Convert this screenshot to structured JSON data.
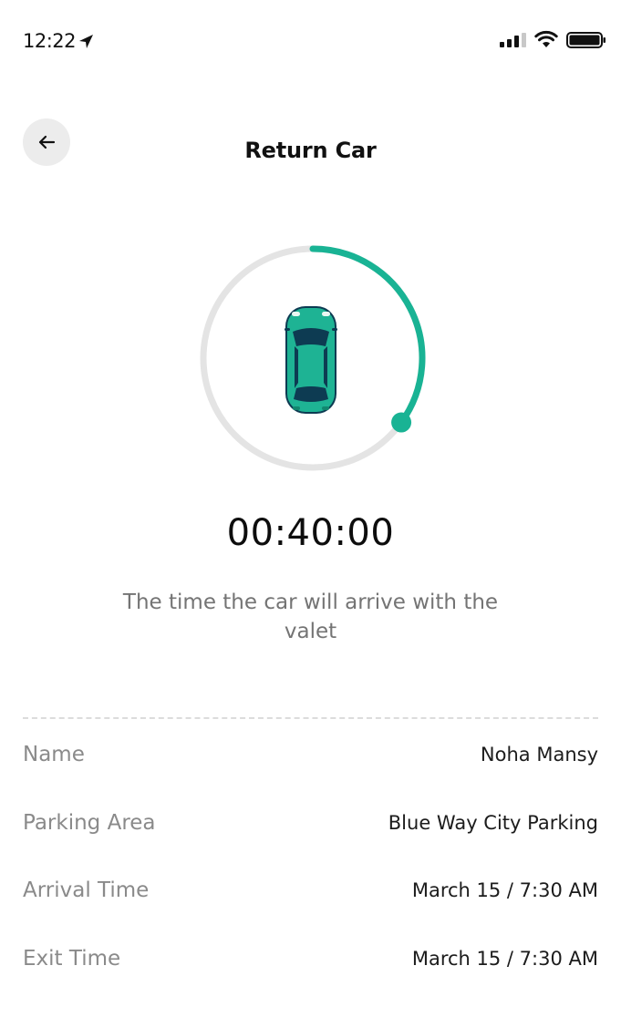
{
  "status_bar": {
    "time": "12:22",
    "icons": [
      "location-arrow-icon",
      "signal-icon",
      "wifi-icon",
      "battery-icon"
    ]
  },
  "header": {
    "title": "Return Car",
    "back_icon": "arrow-left-icon"
  },
  "timer": {
    "progress": 0.35,
    "countdown": "00:40:00",
    "caption": "The time the car will arrive with the valet",
    "vehicle_icon": "car-top-view-icon"
  },
  "details": [
    {
      "label": "Name",
      "value": "Noha Mansy"
    },
    {
      "label": "Parking Area",
      "value": "Blue Way City Parking"
    },
    {
      "label": "Arrival Time",
      "value": "March 15 / 7:30 AM"
    },
    {
      "label": "Exit Time",
      "value": "March 15 / 7:30 AM"
    }
  ],
  "colors": {
    "accent": "#19b394",
    "ring_track": "#e4e4e4",
    "car_body": "#1eb394",
    "car_dark": "#0d3b52",
    "back_button_bg": "#ececec"
  }
}
